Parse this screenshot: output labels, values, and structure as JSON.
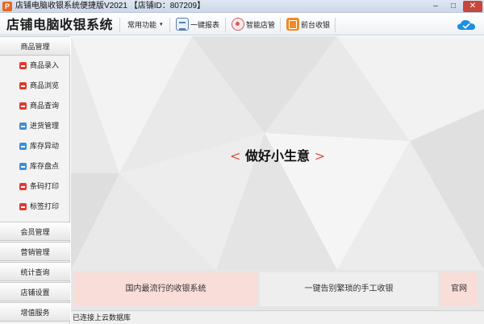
{
  "window": {
    "logo_letter": "P",
    "title": "店铺电脑收银系统便捷版V2021 【店铺ID：807209】",
    "minimize": "–",
    "maximize": "□",
    "close": "✕"
  },
  "toolbar": {
    "brand": "店铺电脑收银系统",
    "common_functions": "常用功能",
    "dropdown_arrow": "▾",
    "report": "一键报表",
    "smart_store": "智能店管",
    "front_cashier": "前台收银",
    "icons": {
      "report": "report-icon",
      "smart_store": "brain-icon",
      "front_cashier": "cashier-icon",
      "cloud": "cloud-check-icon"
    },
    "accent_color": "#f08a25",
    "cloud_color": "#1e8fe1"
  },
  "sidebar": {
    "product_management": "商品管理",
    "items": [
      {
        "label": "商品录入",
        "icon": "red-arrow-icon"
      },
      {
        "label": "商品浏览",
        "icon": "red-arrow-icon"
      },
      {
        "label": "商品查询",
        "icon": "red-arrow-icon"
      },
      {
        "label": "进货管理",
        "icon": "blue-arrow-icon"
      },
      {
        "label": "库存异动",
        "icon": "blue-arrow-icon"
      },
      {
        "label": "库存盘点",
        "icon": "blue-arrow-icon"
      },
      {
        "label": "条码打印",
        "icon": "red-arrow-icon"
      },
      {
        "label": "标签打印",
        "icon": "red-arrow-icon"
      }
    ],
    "sections": [
      "会员管理",
      "营销管理",
      "统计查询",
      "店铺设置",
      "增值服务"
    ]
  },
  "main": {
    "slogan": "做好小生意",
    "slogan_left": "<",
    "slogan_right": ">",
    "banners": [
      "国内最流行的收银系统",
      "一键告别繁琐的手工收银",
      "官网"
    ]
  },
  "status": {
    "text": "已连接上云数据库"
  }
}
